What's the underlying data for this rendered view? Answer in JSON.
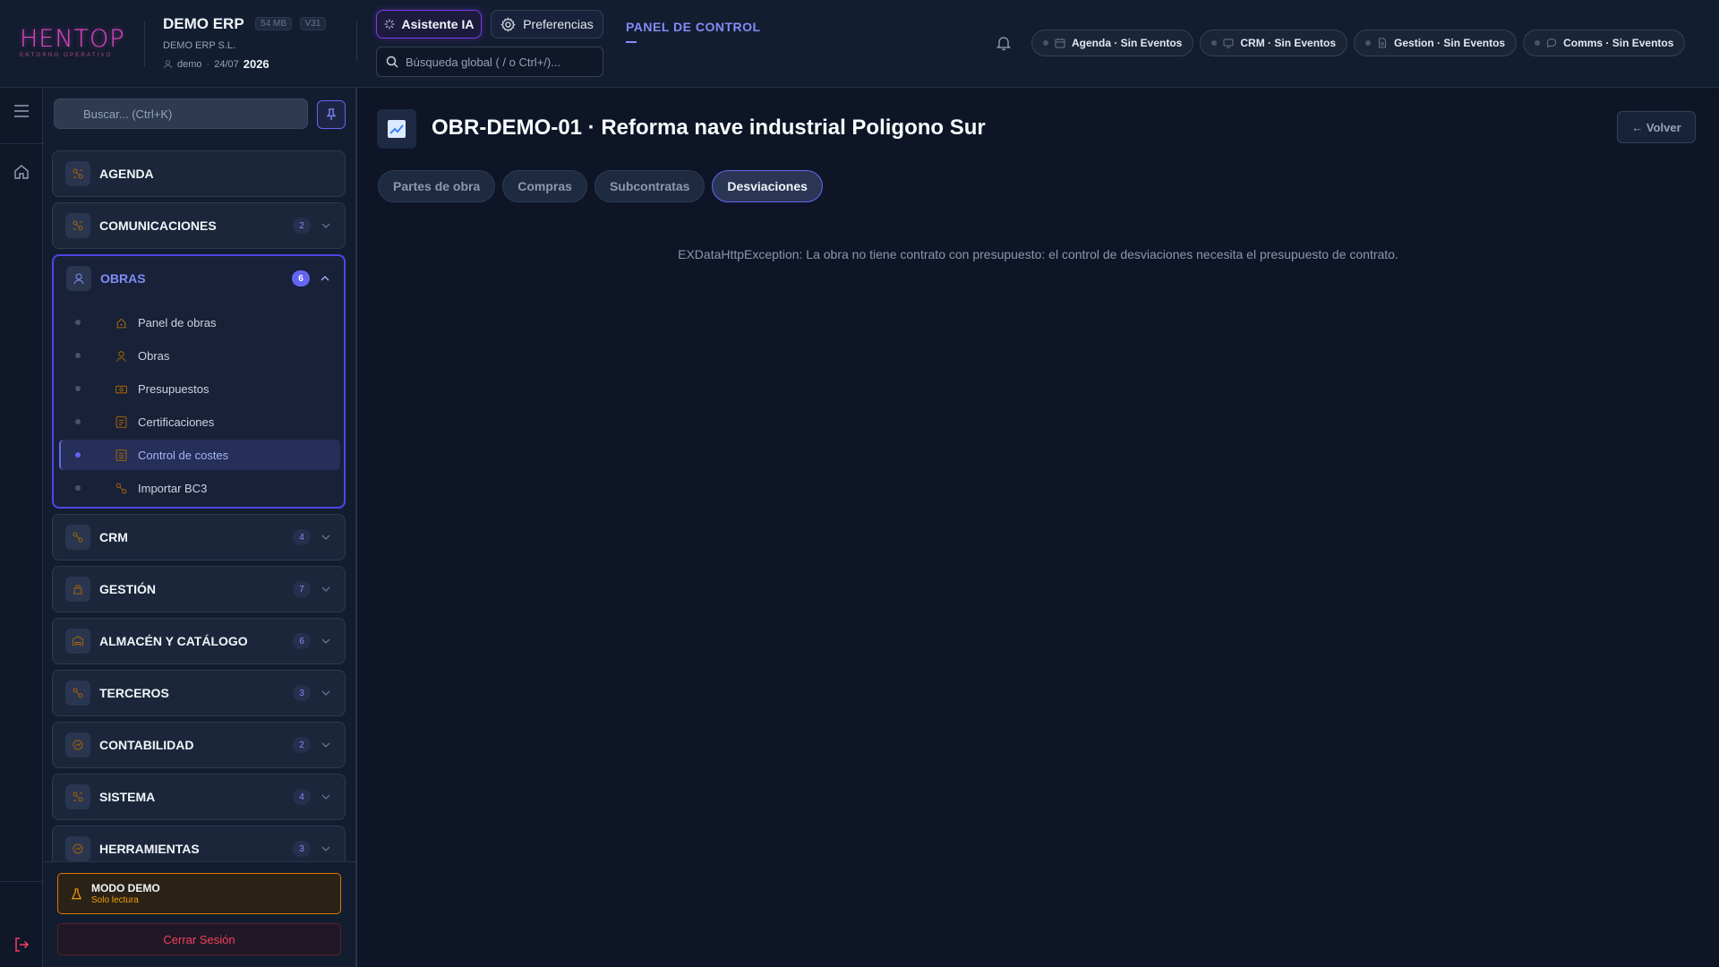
{
  "header": {
    "logo_text": "HENTOP",
    "logo_subtitle": "ENTORNO OPERATIVO",
    "app_title": "DEMO ERP",
    "size_badge": "54 MB",
    "version_badge": "V31",
    "company": "DEMO ERP S.L.",
    "user": "demo",
    "date": "24/07",
    "year": "2026",
    "ai_button": "Asistente IA",
    "prefs_button": "Preferencias",
    "search_placeholder": "Búsqueda global ( / o Ctrl+/)...",
    "panel_title": "PANEL DE CONTROL",
    "chips": [
      {
        "label": "Agenda · Sin Eventos",
        "icon": "calendar-icon"
      },
      {
        "label": "CRM · Sin Eventos",
        "icon": "monitor-icon"
      },
      {
        "label": "Gestion · Sin Eventos",
        "icon": "document-icon"
      },
      {
        "label": "Comms · Sin Eventos",
        "icon": "chat-icon"
      }
    ]
  },
  "sidebar": {
    "search_placeholder": "Buscar... (Ctrl+K)",
    "groups": [
      {
        "label": "AGENDA",
        "badge": null
      },
      {
        "label": "COMUNICACIONES",
        "badge": "2"
      },
      {
        "label": "OBRAS",
        "badge": "6",
        "items": [
          {
            "label": "Panel de obras"
          },
          {
            "label": "Obras"
          },
          {
            "label": "Presupuestos"
          },
          {
            "label": "Certificaciones"
          },
          {
            "label": "Control de costes",
            "active": true
          },
          {
            "label": "Importar BC3"
          }
        ]
      },
      {
        "label": "CRM",
        "badge": "4"
      },
      {
        "label": "GESTIÓN",
        "badge": "7"
      },
      {
        "label": "ALMACÉN Y CATÁLOGO",
        "badge": "6"
      },
      {
        "label": "TERCEROS",
        "badge": "3"
      },
      {
        "label": "CONTABILIDAD",
        "badge": "2"
      },
      {
        "label": "SISTEMA",
        "badge": "4"
      },
      {
        "label": "HERRAMIENTAS",
        "badge": "3"
      }
    ],
    "demo_title": "MODO DEMO",
    "demo_subtitle": "Solo lectura",
    "logout": "Cerrar Sesión"
  },
  "main": {
    "title": "OBR-DEMO-01 · Reforma nave industrial Poligono Sur",
    "back_button": "← Volver",
    "tabs": [
      {
        "label": "Partes de obra",
        "active": false
      },
      {
        "label": "Compras",
        "active": false
      },
      {
        "label": "Subcontratas",
        "active": false
      },
      {
        "label": "Desviaciones",
        "active": true
      }
    ],
    "error": "EXDataHttpException: La obra no tiene contrato con presupuesto: el control de desviaciones necesita el presupuesto de contrato."
  },
  "colors": {
    "accent": "#6366f1",
    "brand": "#e247c6",
    "warning": "#f59e0b",
    "danger": "#f43f5e",
    "background": "#0d1526"
  }
}
